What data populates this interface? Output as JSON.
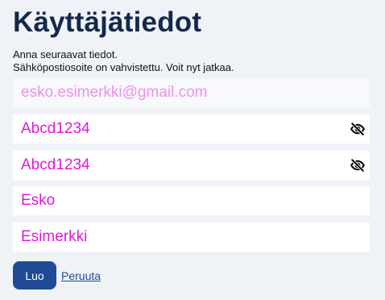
{
  "page": {
    "title": "Käyttäjätiedot",
    "intro_line1": "Anna seuraavat tiedot.",
    "intro_line2": "Sähköpostiosoite on vahvistettu. Voit nyt jatkaa."
  },
  "form": {
    "email": "esko.esimerkki@gmail.com",
    "password": "Abcd1234",
    "password_confirm": "Abcd1234",
    "first_name": "Esko",
    "last_name": "Esimerkki"
  },
  "icons": {
    "password_toggle": "eye-off-icon",
    "password_confirm_toggle": "eye-off-icon"
  },
  "actions": {
    "create_label": "Luo",
    "cancel_label": "Peruuta"
  },
  "colors": {
    "title": "#13294b",
    "field_text": "#e01ad8",
    "button": "#1f4b96",
    "background": "#eff3f8"
  }
}
